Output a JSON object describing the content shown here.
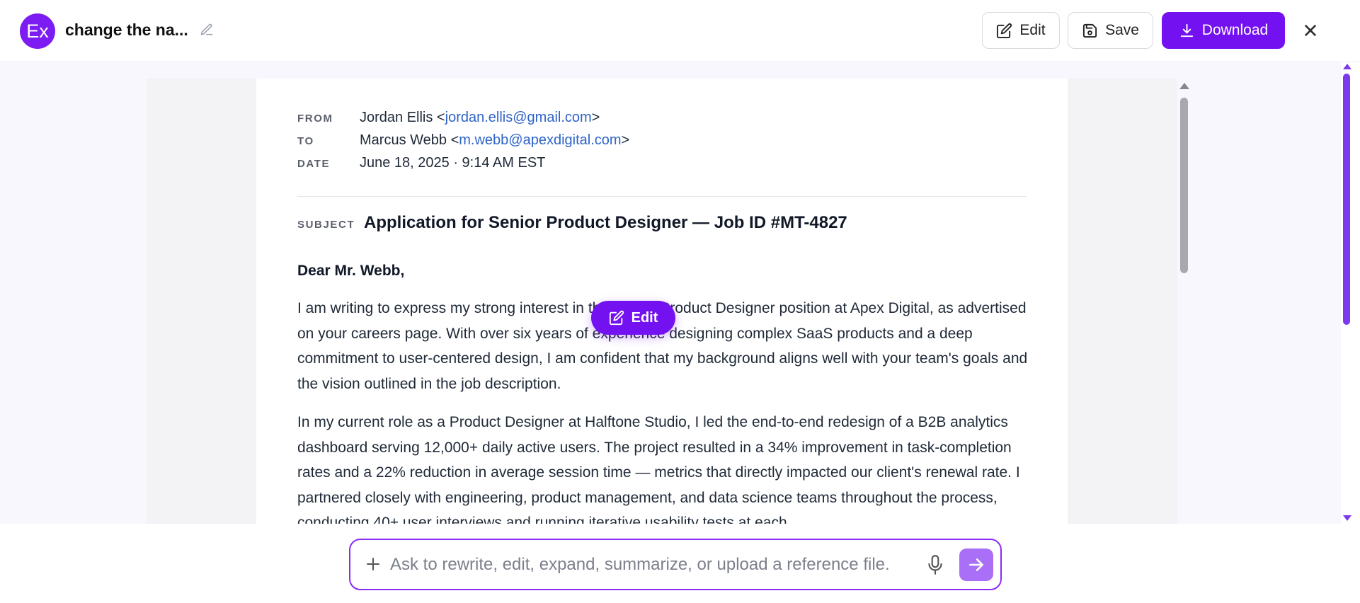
{
  "header": {
    "avatar_initials": "Ex",
    "doc_title": "change the na...",
    "edit_label": "Edit",
    "save_label": "Save",
    "download_label": "Download"
  },
  "email": {
    "from_label": "FROM",
    "from_name": "Jordan Ellis <",
    "from_email": "jordan.ellis@gmail.com",
    "from_close": ">",
    "to_label": "TO",
    "to_name": "Marcus Webb <",
    "to_email": "m.webb@apexdigital.com",
    "to_close": ">",
    "date_label": "DATE",
    "date_value": "June 18, 2025 · 9:14 AM EST",
    "subject_label": "SUBJECT",
    "subject": "Application for Senior Product Designer — Job ID #MT-4827",
    "greeting": "Dear Mr. Webb,",
    "paragraph1": "I am writing to express my strong interest in the Senior Product Designer position at Apex Digital, as advertised on your careers page. With over six years of experience designing complex SaaS products and a deep commitment to user-centered design, I am confident that my background aligns well with your team's goals and the vision outlined in the job description.",
    "paragraph2": "In my current role as a Product Designer at Halftone Studio, I led the end-to-end redesign of a B2B analytics dashboard serving 12,000+ daily active users. The project resulted in a 34% improvement in task-completion rates and a 22% reduction in average session time — metrics that directly impacted our client's renewal rate. I partnered closely with engineering, product management, and data science teams throughout the process, conducting 40+ user interviews and running iterative usability tests at each"
  },
  "floating": {
    "edit_label": "Edit"
  },
  "chat": {
    "placeholder": "Ask to rewrite, edit, expand, summarize, or upload a reference file."
  },
  "colors": {
    "accent": "#7411f0",
    "link": "#2e63c9",
    "send_button": "#a970f7"
  }
}
